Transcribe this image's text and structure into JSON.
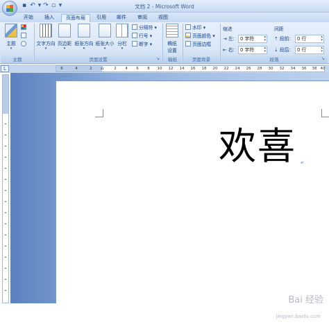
{
  "window": {
    "title": "文档 2 - Microsoft Word"
  },
  "quick_access": {
    "icons": [
      "save-icon",
      "undo-icon",
      "redo-icon",
      "new-doc-icon",
      "customize-icon"
    ]
  },
  "ribbon": {
    "tabs": [
      {
        "label": "开始",
        "active": false
      },
      {
        "label": "插入",
        "active": false
      },
      {
        "label": "页面布局",
        "active": true
      },
      {
        "label": "引用",
        "active": false
      },
      {
        "label": "邮件",
        "active": false
      },
      {
        "label": "审阅",
        "active": false
      },
      {
        "label": "视图",
        "active": false
      }
    ],
    "groups": {
      "themes": {
        "label": "主题",
        "theme_button": "主题"
      },
      "page_setup": {
        "label": "页面设置",
        "text_direction": "文字方向",
        "margins": "页边距",
        "orientation": "纸张方向",
        "size": "纸张大小",
        "columns": "分栏",
        "breaks": "分隔符",
        "line_numbers": "行号",
        "hyphenation": "断字"
      },
      "draft_paper": {
        "label": "稿纸",
        "button_line1": "稿纸",
        "button_line2": "设置"
      },
      "page_background": {
        "label": "页面背景",
        "watermark": "水印",
        "page_color": "页面颜色",
        "page_borders": "页面边框"
      },
      "paragraph": {
        "label": "段落",
        "indent_header": "缩进",
        "spacing_header": "间距",
        "indent_left_label": "左:",
        "indent_left_value": "0 字符",
        "indent_right_label": "右:",
        "indent_right_value": "0 字符",
        "spacing_before_label": "段前:",
        "spacing_before_value": "0 行",
        "spacing_after_label": "段后:",
        "spacing_after_value": "0 行"
      }
    }
  },
  "ruler": {
    "corner_symbol": "L",
    "numbers": [
      "6",
      "4",
      "2",
      "2",
      "4",
      "6",
      "8",
      "10",
      "12",
      "14",
      "16",
      "18",
      "20",
      "22",
      "24",
      "26",
      "28",
      "30",
      "32",
      "34",
      "36",
      "38",
      "40"
    ]
  },
  "document": {
    "text": "欢喜",
    "paragraph_mark": "↵"
  },
  "watermark": {
    "main": "Bai 经验",
    "sub": "jingyan.baidu.com"
  },
  "colors": {
    "ribbon_bg": "#dbe8f7",
    "workspace": "#8fb0de",
    "text": "#15428b"
  }
}
